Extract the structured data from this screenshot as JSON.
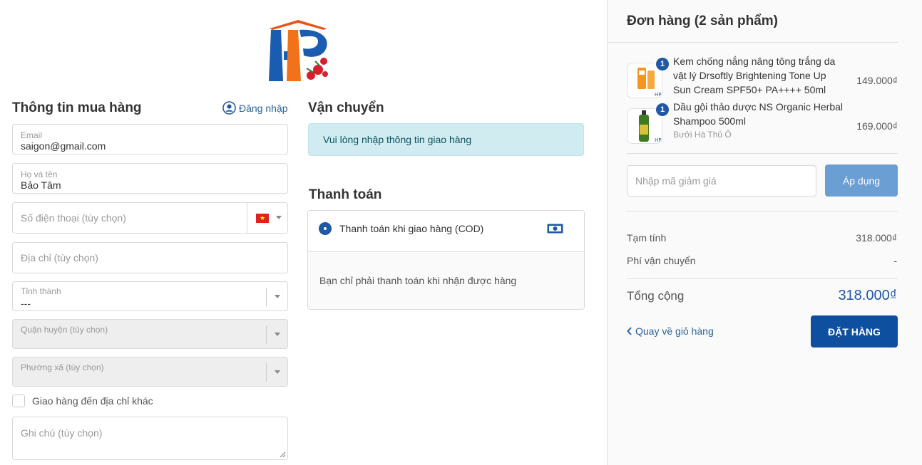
{
  "customer": {
    "title": "Thông tin mua hàng",
    "login_label": "Đăng nhập",
    "email_label": "Email",
    "email_value": "saigon@gmail.com",
    "name_label": "Họ và tên",
    "name_value": "Bảo Tâm",
    "phone_placeholder": "Số điện thoại (tùy chọn)",
    "address_placeholder": "Địa chỉ (tùy chọn)",
    "province_label": "Tỉnh thành",
    "province_value": "---",
    "district_placeholder": "Quận huyện (tùy chọn)",
    "ward_placeholder": "Phường xã (tùy chọn)",
    "ship_other_label": "Giao hàng đến địa chỉ khác",
    "note_placeholder": "Ghi chú (tùy chọn)"
  },
  "shipping": {
    "title": "Vận chuyển",
    "alert": "Vui lòng nhập thông tin giao hàng"
  },
  "payment": {
    "title": "Thanh toán",
    "method_label": "Thanh toán khi giao hàng (COD)",
    "method_icon": "cash-icon",
    "description": "Bạn chỉ phải thanh toán khi nhận được hàng"
  },
  "order": {
    "title": "Đơn hàng (2 sản phẩm)",
    "items": [
      {
        "quantity": "1",
        "name": "Kem chống nắng nâng tông trắng da vật lý Drsoftly Brightening Tone Up Sun Cream SPF50+ PA++++ 50ml",
        "variant": "",
        "price": "149.000₫"
      },
      {
        "quantity": "1",
        "name": "Dầu gội thảo dược NS Organic Herbal Shampoo 500ml",
        "variant": "Bưởi Hà Thủ Ô",
        "price": "169.000₫"
      }
    ],
    "discount_placeholder": "Nhập mã giảm giá",
    "apply_label": "Áp dụng",
    "subtotal_label": "Tạm tính",
    "subtotal_value": "318.000₫",
    "shipping_fee_label": "Phí vận chuyển",
    "shipping_fee_value": "-",
    "total_label": "Tổng cộng",
    "total_value": "318.000₫",
    "back_label": "Quay về giỏ hàng",
    "submit_label": "ĐẶT HÀNG"
  },
  "colors": {
    "primary": "#1f58a5",
    "apply_button": "#6b9ed2",
    "alert_bg": "#d1ecf1",
    "alert_text": "#0c5460"
  }
}
